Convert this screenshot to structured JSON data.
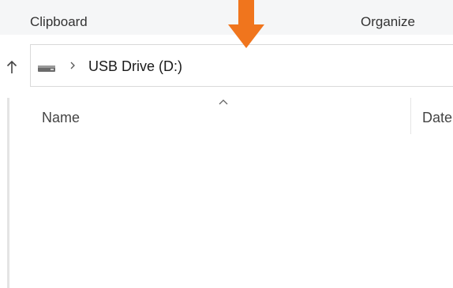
{
  "ribbon": {
    "groups": [
      {
        "label": "Clipboard"
      },
      {
        "label": "Organize"
      }
    ]
  },
  "annotation": {
    "icon": "arrow-down-icon",
    "color": "#f0751d"
  },
  "navigation": {
    "up_icon": "arrow-up-icon",
    "address": {
      "drive_icon": "usb-drive-icon",
      "separator_icon": "chevron-right-icon",
      "location": "USB Drive (D:)"
    }
  },
  "file_list": {
    "columns": [
      {
        "label": "Name",
        "sort": "ascending"
      },
      {
        "label": "Date"
      }
    ],
    "items": []
  }
}
